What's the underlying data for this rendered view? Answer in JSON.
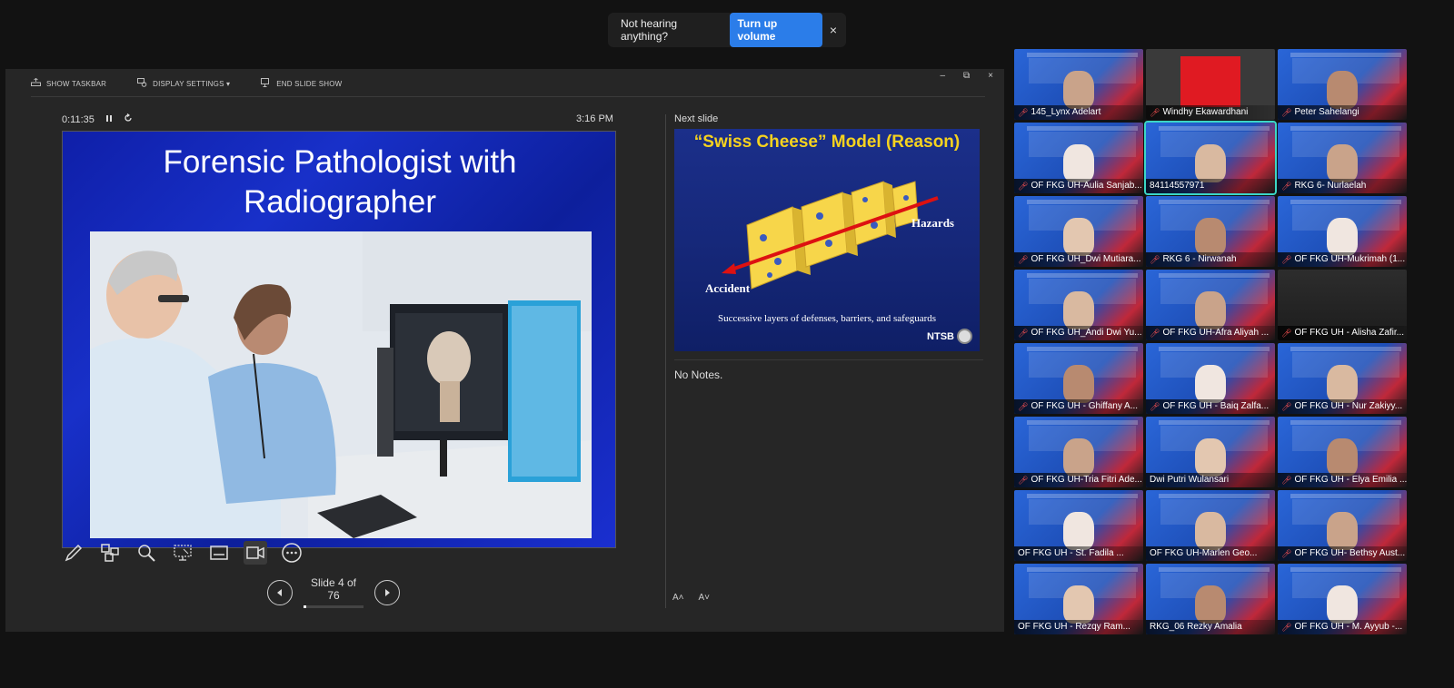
{
  "notification": {
    "text": "Not hearing anything?",
    "button": "Turn up volume",
    "close": "×"
  },
  "toolbar": {
    "show_taskbar": "SHOW TASKBAR",
    "display_settings": "DISPLAY SETTINGS ▾",
    "end_slide_show": "END SLIDE SHOW"
  },
  "window_controls": {
    "minimize": "–",
    "restore": "⧉",
    "close": "×"
  },
  "timer": {
    "elapsed": "0:11:35",
    "clock": "3:16 PM"
  },
  "current_slide": {
    "title": "Forensic Pathologist with Radiographer"
  },
  "next_slide": {
    "label": "Next slide",
    "title": "“Swiss Cheese” Model (Reason)",
    "hazards": "Hazards",
    "accident": "Accident",
    "caption": "Successive layers of defenses, barriers, and safeguards",
    "logo": "NTSB"
  },
  "notes": {
    "text": "No Notes."
  },
  "font_controls": {
    "increase": "A˄",
    "decrease": "A˅"
  },
  "navigation": {
    "slide_label": "Slide 4 of 76",
    "progress": 0.0526
  },
  "participants": [
    {
      "name": "145_Lynx Adelart",
      "muted": true,
      "kind": "camera"
    },
    {
      "name": "Windhy Ekawardhani",
      "muted": true,
      "kind": "avatar"
    },
    {
      "name": "Peter Sahelangi",
      "muted": true,
      "kind": "camera"
    },
    {
      "name": "OF FKG UH-Aulia Sanjab...",
      "muted": true,
      "kind": "camera"
    },
    {
      "name": "84114557971",
      "muted": false,
      "kind": "camera",
      "selected": true
    },
    {
      "name": "RKG 6- Nurlaelah",
      "muted": true,
      "kind": "camera"
    },
    {
      "name": "OF FKG UH_Dwi Mutiara...",
      "muted": true,
      "kind": "camera"
    },
    {
      "name": "RKG 6 - Nirwanah",
      "muted": true,
      "kind": "camera"
    },
    {
      "name": "OF FKG UH-Mukrimah (1...",
      "muted": true,
      "kind": "camera"
    },
    {
      "name": "OF FKG UH_Andi Dwi Yu...",
      "muted": true,
      "kind": "camera"
    },
    {
      "name": "OF FKG UH-Afra Aliyah ...",
      "muted": true,
      "kind": "camera"
    },
    {
      "name": "OF FKG UH - Alisha Zafir...",
      "muted": true,
      "kind": "dark"
    },
    {
      "name": "OF FKG UH - Ghiffany A...",
      "muted": true,
      "kind": "camera"
    },
    {
      "name": "OF FKG UH - Baiq Zalfa...",
      "muted": true,
      "kind": "camera"
    },
    {
      "name": "OF FKG UH - Nur Zakiyy...",
      "muted": true,
      "kind": "camera"
    },
    {
      "name": "OF FKG UH-Tria Fitri Ade...",
      "muted": true,
      "kind": "camera"
    },
    {
      "name": "Dwi Putri Wulansari",
      "muted": false,
      "kind": "camera"
    },
    {
      "name": "OF FKG UH - Elya Emilia ...",
      "muted": true,
      "kind": "camera"
    },
    {
      "name": "OF FKG UH - St. Fadila ...",
      "muted": false,
      "kind": "camera"
    },
    {
      "name": "OF FKG UH-Marlen Geo...",
      "muted": false,
      "kind": "camera"
    },
    {
      "name": "OF FKG UH- Bethsy Aust...",
      "muted": true,
      "kind": "camera"
    },
    {
      "name": "OF FKG UH - Rezqy Ram...",
      "muted": false,
      "kind": "camera"
    },
    {
      "name": "RKG_06 Rezky Amalia",
      "muted": false,
      "kind": "camera"
    },
    {
      "name": "OF FKG UH - M. Ayyub -...",
      "muted": true,
      "kind": "camera"
    }
  ],
  "colors": {
    "accent": "#2b7de9",
    "slide_blue": "#1830c9",
    "cheese": "#f5d21e",
    "muted_red": "#ff5252",
    "selected": "#3bd6c6"
  }
}
